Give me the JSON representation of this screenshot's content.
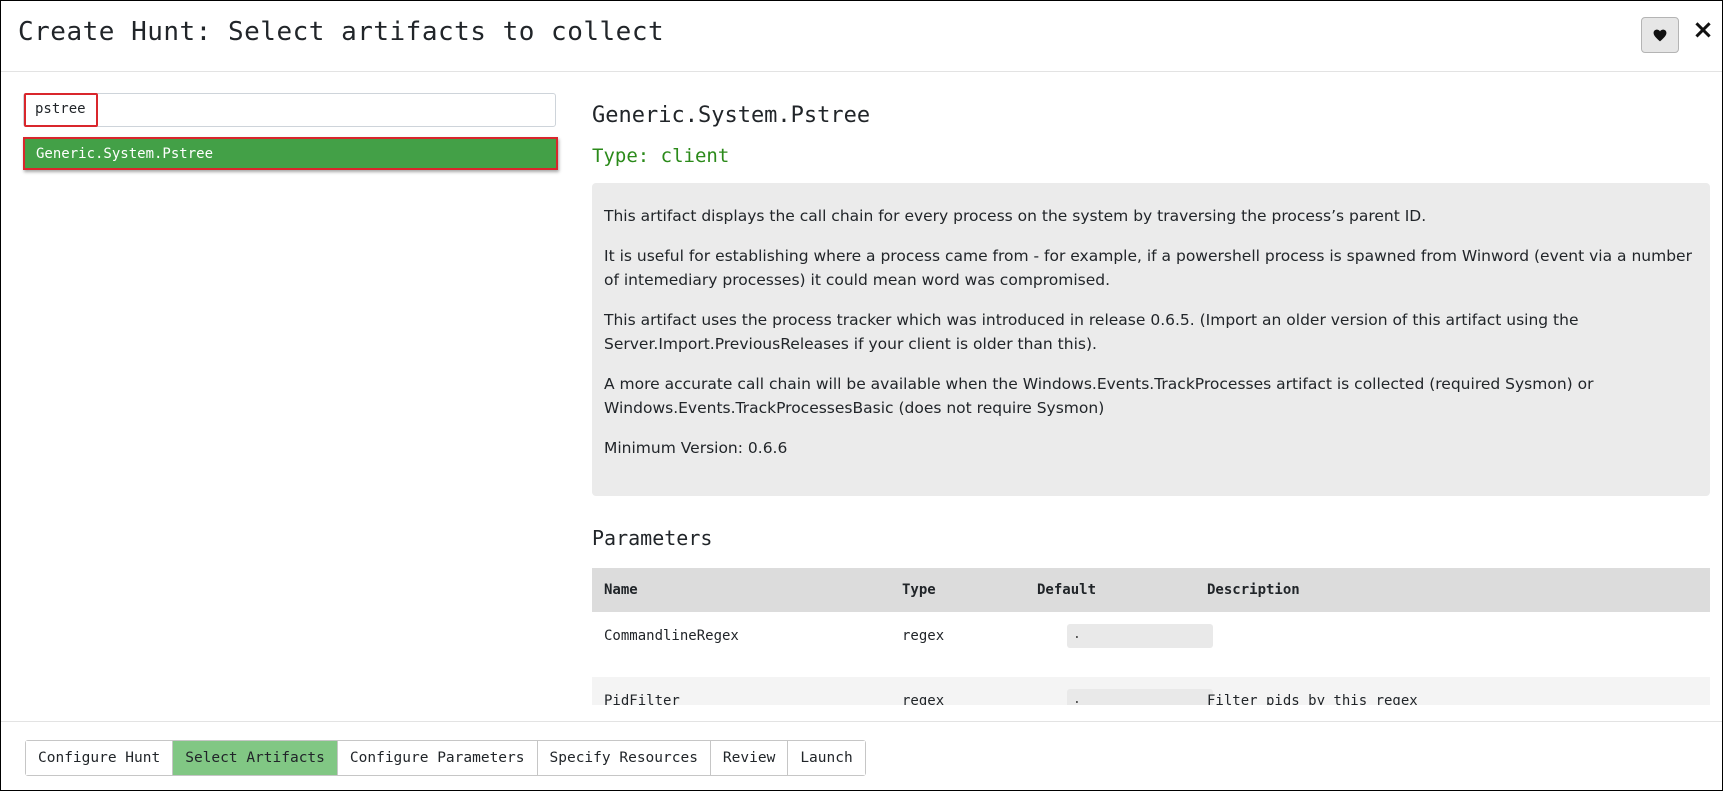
{
  "header": {
    "title": "Create Hunt: Select artifacts to collect",
    "favorite_icon": "heart-icon",
    "close_label": "×"
  },
  "search": {
    "value": "pstree",
    "results": [
      "Generic.System.Pstree"
    ]
  },
  "artifact": {
    "name": "Generic.System.Pstree",
    "type": "Type: client",
    "description": [
      "This artifact displays the call chain for every process on the system by traversing the process’s parent ID.",
      "It is useful for establishing where a process came from - for example, if a powershell process is spawned from Winword (event via a number of intemediary processes) it could mean word was compromised.",
      "This artifact uses the process tracker which was introduced in release 0.6.5. (Import an older version of this artifact using the Server.Import.PreviousReleases if your client is older than this).",
      "A more accurate call chain will be available when the Windows.Events.TrackProcesses artifact is collected (required Sysmon) or Windows.Events.TrackProcessesBasic (does not require Sysmon)",
      "Minimum Version: 0.6.6"
    ]
  },
  "parameters": {
    "title": "Parameters",
    "columns": [
      "Name",
      "Type",
      "Default",
      "Description"
    ],
    "rows": [
      {
        "name": "CommandlineRegex",
        "type": "regex",
        "default": ".",
        "description": ""
      },
      {
        "name": "PidFilter",
        "type": "regex",
        "default": ".",
        "description": "Filter pids by this regex"
      }
    ]
  },
  "wizard": {
    "steps": [
      "Configure Hunt",
      "Select Artifacts",
      "Configure Parameters",
      "Specify Resources",
      "Review",
      "Launch"
    ],
    "active": "Select Artifacts"
  },
  "colors": {
    "selected_result": "#43a047",
    "active_step": "#81c784",
    "highlight_border": "#d9262c",
    "type_text": "#2b8a1a"
  }
}
